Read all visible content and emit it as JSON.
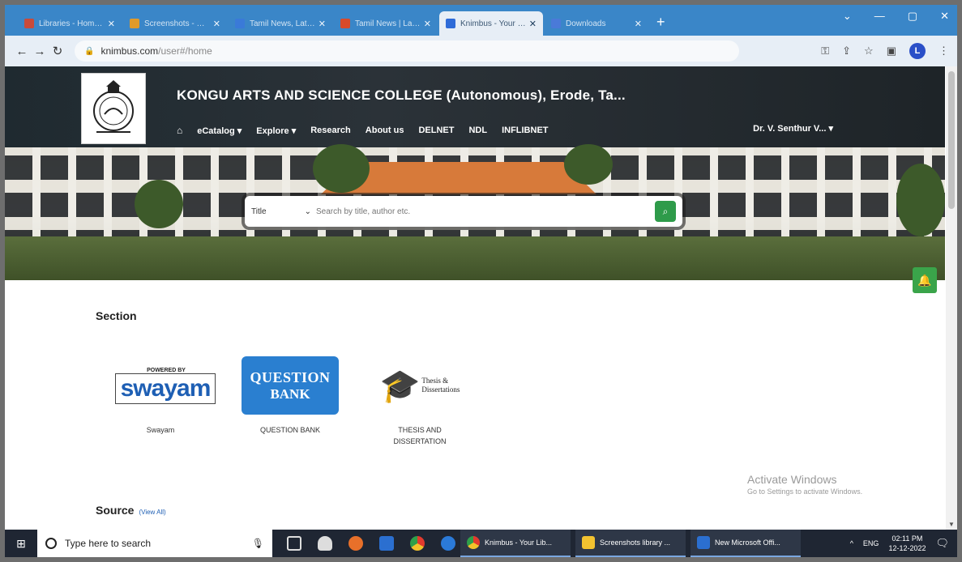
{
  "browser": {
    "tabs": [
      {
        "label": "Libraries - Home Page",
        "color": "#c84a3a"
      },
      {
        "label": "Screenshots - my ...",
        "color": "#e09a2a"
      },
      {
        "label": "Tamil News, Latest Ta...",
        "color": "#3a7ad8"
      },
      {
        "label": "Tamil News | Latest",
        "color": "#d84a2a"
      },
      {
        "label": "Knimbus - Your Libra...",
        "color": "#2e6bd8",
        "active": true
      },
      {
        "label": "Downloads",
        "color": "#4a7ad8"
      }
    ],
    "new_tab": "+",
    "url_domain": "knimbus.com",
    "url_path": "/user#/home"
  },
  "header": {
    "college_name": "KONGU ARTS AND SCIENCE COLLEGE (Autonomous), Erode, Ta...",
    "nav": [
      "eCatalog ▾",
      "Explore ▾",
      "Research",
      "About us",
      "DELNET",
      "NDL",
      "INFLIBNET"
    ],
    "user": "Dr. V. Senthur V... ▾"
  },
  "search": {
    "type_label": "Title",
    "placeholder": "Search by title, author etc."
  },
  "section": {
    "title": "Section",
    "cards": [
      {
        "caption": "Swayam",
        "top": "POWERED BY",
        "word": "swayam"
      },
      {
        "caption": "QUESTION BANK",
        "l1": "QUESTION",
        "l2": "BANK"
      },
      {
        "caption": "THESIS AND DISSERTATION",
        "t1": "Thesis &",
        "t2": "Dissertations"
      }
    ]
  },
  "activate": {
    "line1": "Activate Windows",
    "line2": "Go to Settings to activate Windows."
  },
  "source": {
    "title": "Source",
    "view_all": "(View All)"
  },
  "taskbar": {
    "search_placeholder": "Type here to search",
    "apps": [
      {
        "label": "Knimbus - Your Lib...",
        "color": "#e0a020"
      },
      {
        "label": "Screenshots library ...",
        "color": "#f2c230"
      },
      {
        "label": "New Microsoft Offi...",
        "color": "#2b6fd0"
      }
    ],
    "lang": "ENG",
    "time": "02:11 PM",
    "date": "12-12-2022"
  }
}
